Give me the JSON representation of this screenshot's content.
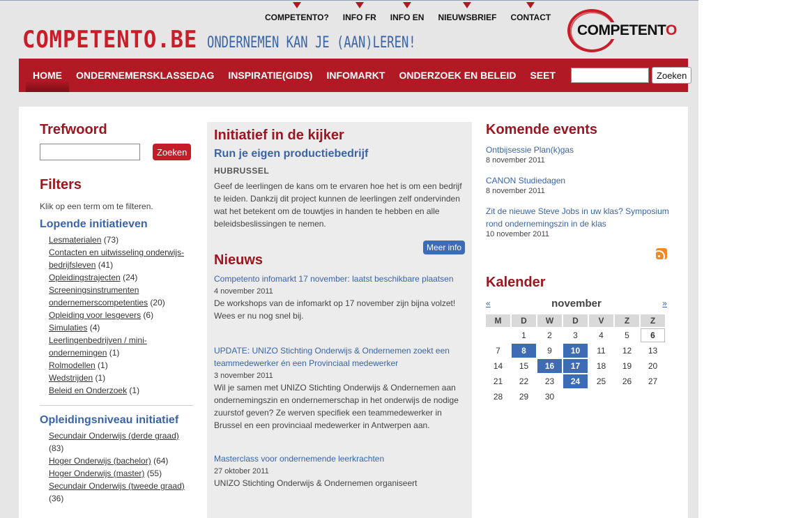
{
  "top_nav": [
    "COMPETENTO?",
    "INFO FR",
    "INFO EN",
    "NIEUWSBRIEF",
    "CONTACT"
  ],
  "brand": {
    "site": "COMPETENTO.BE",
    "tagline": "ONDERNEMEN KAN JE (AAN)LEREN!",
    "logo_prefix": "COMPETENT",
    "logo_suffix": "O"
  },
  "main_nav": [
    "HOME",
    "ONDERNEMERSKLASSEDAG",
    "INSPIRATIE(GIDS)",
    "INFOMARKT",
    "ONDERZOEK EN BELEID",
    "SEET"
  ],
  "main_search": {
    "button": "Zoeken",
    "value": ""
  },
  "left": {
    "keyword_title": "Trefwoord",
    "keyword_button": "Zoeken",
    "filters_title": "Filters",
    "filters_hint": "Klik op een term om te filteren.",
    "facet1_title": "Lopende initiatieven",
    "facet1_items": [
      {
        "label": "Lesmaterialen",
        "count": "(73)"
      },
      {
        "label": "Contacten en uitwisseling onderwijs-bedrijfsleven",
        "count": "(41)"
      },
      {
        "label": "Opleidingstrajecten",
        "count": "(24)"
      },
      {
        "label": "Screeningsinstrumenten ondernemerscompetenties",
        "count": "(20)"
      },
      {
        "label": "Opleiding voor lesgevers",
        "count": "(6)"
      },
      {
        "label": "Simulaties",
        "count": "(4)"
      },
      {
        "label": "Leerlingenbedrijven / mini-ondernemingen",
        "count": "(1)"
      },
      {
        "label": "Rolmodellen",
        "count": "(1)"
      },
      {
        "label": "Wedstrijden",
        "count": "(1)"
      },
      {
        "label": "Beleid en Onderzoek",
        "count": "(1)"
      }
    ],
    "facet2_title": "Opleidingsniveau initiatief",
    "facet2_items": [
      {
        "label": "Secundair Onderwijs (derde graad)",
        "count": "(83)"
      },
      {
        "label": "Hoger Onderwijs (bachelor)",
        "count": "(64)"
      },
      {
        "label": "Hoger Onderwijs (master)",
        "count": "(55)"
      },
      {
        "label": "Secundair Onderwijs (tweede graad)",
        "count": "(36)"
      }
    ]
  },
  "middle": {
    "spotlight_title": "Initiatief in de kijker",
    "spotlight_subtitle": "Run je eigen productiebedrijf",
    "spotlight_org": "HUBRUSSEL",
    "spotlight_text": "Geef de leerlingen de kans om te ervaren hoe het is om een bedrijf te leiden. Dankzij dit project kunnen de leerlingen zelf ondervinden wat het betekent om de touwtjes in handen te hebben en alle beleidsbeslissingen te nemen.",
    "more_button": "Meer info",
    "news_title": "Nieuws",
    "news": [
      {
        "title": "Competento infomarkt 17 november: laatst beschikbare plaatsen",
        "date": "4 november 2011",
        "text": "De workshops van de infomarkt op 17 november zijn bijna volzet! Wees er nu nog snel bij."
      },
      {
        "title": "UPDATE: UNIZO Stichting Onderwijs & Ondernemen zoekt een teammedewerker én een Provinciaal medewerker",
        "date": "3 november 2011",
        "text": "Wil je samen met UNIZO Stichting Onderwijs & Ondernemen aan ondernemingszin en ondernemerschap in het onderwijs de nodige zuurstof geven? Ze werven specifiek een teammedewerker in Brussel en een provinciaal medewerker in Antwerpen aan."
      },
      {
        "title": "Masterclass voor ondernemende leerkrachten",
        "date": "27 oktober 2011",
        "text": "UNIZO Stichting Onderwijs & Ondernemen organiseert"
      }
    ]
  },
  "right": {
    "events_title": "Komende events",
    "events": [
      {
        "title": "Ontbijsessie Plan(k)gas",
        "date": "8 november 2011"
      },
      {
        "title": "CANON Studiedagen",
        "date": "8 november 2011"
      },
      {
        "title": "Zit de nieuwe Steve Jobs in uw klas? Symposium rond ondernemingszin in de klas",
        "date": "10 november 2011"
      }
    ],
    "calendar_title": "Kalender",
    "calendar": {
      "prev": "«",
      "next": "»",
      "month": "november",
      "weekdays": [
        "M",
        "D",
        "W",
        "D",
        "V",
        "Z",
        "Z"
      ],
      "weeks": [
        [
          "",
          "1",
          "2",
          "3",
          "4",
          "5",
          "6"
        ],
        [
          "7",
          "8",
          "9",
          "10",
          "11",
          "12",
          "13"
        ],
        [
          "14",
          "15",
          "16",
          "17",
          "18",
          "19",
          "20"
        ],
        [
          "21",
          "22",
          "23",
          "24",
          "25",
          "26",
          "27"
        ],
        [
          "28",
          "29",
          "30",
          "",
          "",
          "",
          ""
        ]
      ],
      "event_days": [
        "8",
        "10",
        "16",
        "17",
        "24"
      ],
      "today": "6"
    }
  },
  "colors": {
    "brand_red": "#b11a25",
    "link_blue": "#3a64a8",
    "event_blue": "#3d6bb4",
    "rss_orange": "#f08a24"
  },
  "icons": [
    "rss-feed-icon",
    "top-nav-marker-triangle"
  ]
}
